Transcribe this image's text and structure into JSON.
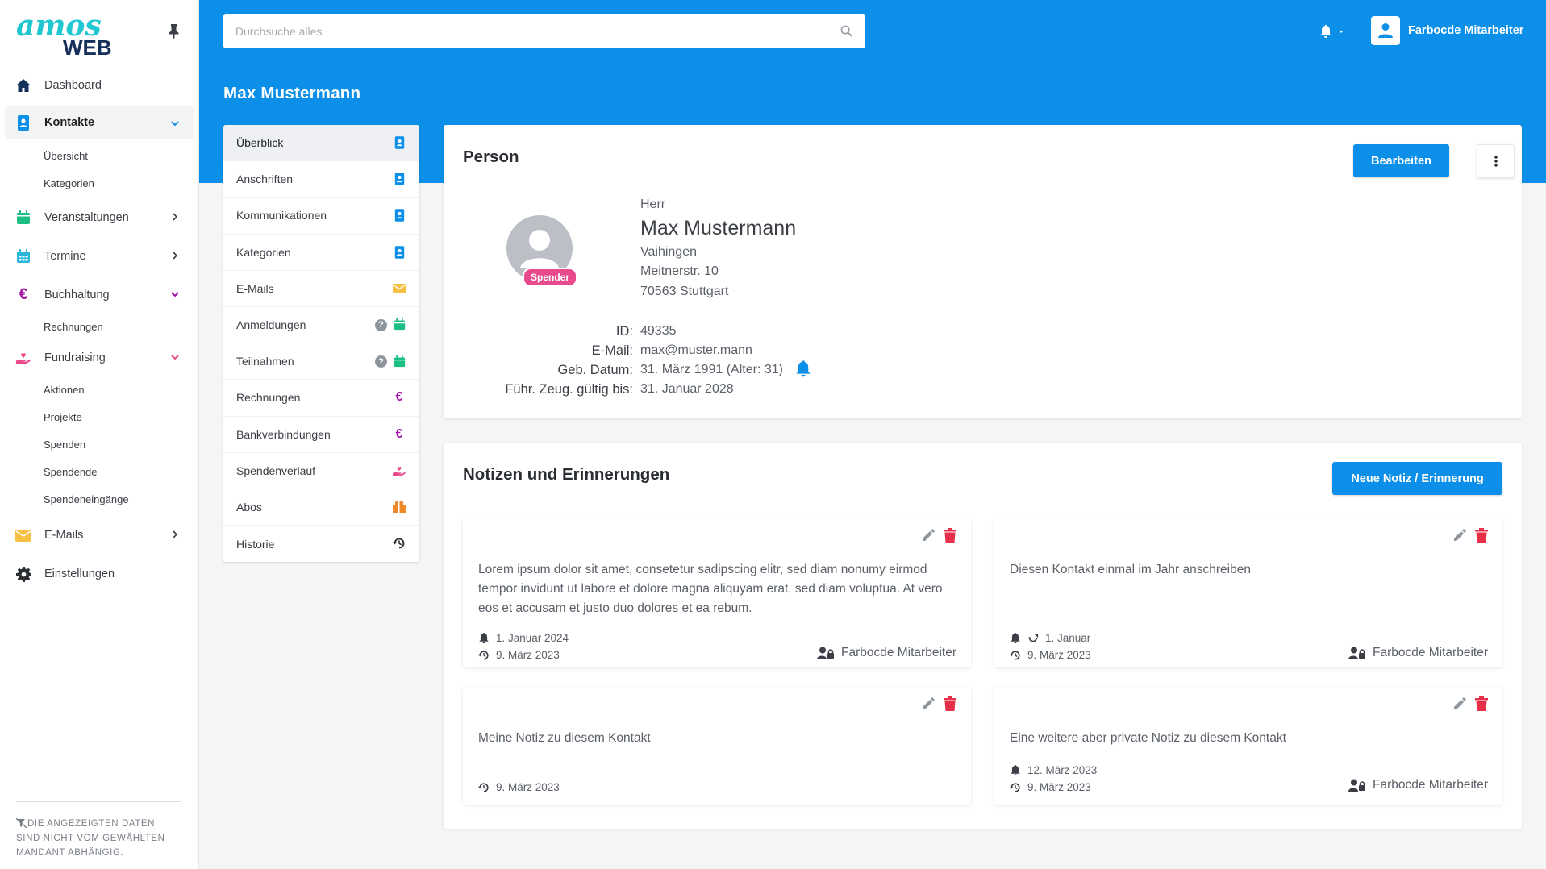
{
  "brand": {
    "logo_text_top": "amos",
    "logo_text_bottom": "WEB"
  },
  "sidebar": {
    "dashboard": "Dashboard",
    "kontakte": "Kontakte",
    "kontakte_sub": [
      "Übersicht",
      "Kategorien"
    ],
    "veranstaltungen": "Veranstaltungen",
    "termine": "Termine",
    "buchhaltung": "Buchhaltung",
    "buchhaltung_sub": [
      "Rechnungen"
    ],
    "fundraising": "Fundraising",
    "fundraising_sub": [
      "Aktionen",
      "Projekte",
      "Spenden",
      "Spendende",
      "Spendeneingänge"
    ],
    "emails": "E-Mails",
    "einstellungen": "Einstellungen",
    "footer_note_1": "Die angezeigten Daten",
    "footer_note_2": "sind nicht vom gewählten",
    "footer_note_3": "Mandant abhängig."
  },
  "header": {
    "search_placeholder": "Durchsuche alles",
    "user_name": "Farbocde Mitarbeiter",
    "page_title": "Max Mustermann"
  },
  "submenu": [
    "Überblick",
    "Anschriften",
    "Kommunikationen",
    "Kategorien",
    "E-Mails",
    "Anmeldungen",
    "Teilnahmen",
    "Rechnungen",
    "Bankverbindungen",
    "Spendenverlauf",
    "Abos",
    "Historie"
  ],
  "person": {
    "card_title": "Person",
    "edit_button": "Bearbeiten",
    "badge": "Spender",
    "salutation": "Herr",
    "name": "Max Mustermann",
    "district": "Vaihingen",
    "street": "Meitnerstr. 10",
    "city": "70563 Stuttgart",
    "id_label": "ID:",
    "id_value": "49335",
    "email_label": "E-Mail:",
    "email_value": "max@muster.mann",
    "birth_label": "Geb. Datum:",
    "birth_value": "31. März 1991 (Alter: 31)",
    "license_label": "Führ. Zeug. gültig bis:",
    "license_value": "31. Januar 2028"
  },
  "notes": {
    "card_title": "Notizen und Erinnerungen",
    "new_button": "Neue Notiz / Erinnerung",
    "items": [
      {
        "text": "Lorem ipsum dolor sit amet, consetetur sadipscing elitr, sed diam nonumy eirmod tempor invidunt ut labore et dolore magna aliquyam erat, sed diam voluptua. At vero eos et accusam et justo duo dolores et ea rebum.",
        "reminder": "1. Januar 2024",
        "created": "9. März 2023",
        "author": "Farbocde Mitarbeiter"
      },
      {
        "text": "Diesen Kontakt einmal im Jahr anschreiben",
        "reminder": "1. Januar",
        "created": "9. März 2023",
        "author": "Farbocde Mitarbeiter"
      },
      {
        "text": "Meine Notiz zu diesem Kontakt",
        "created": "9. März 2023"
      },
      {
        "text": "Eine weitere aber private Notiz zu diesem Kontakt",
        "reminder": "12. März 2023",
        "created": "9. März 2023",
        "author": "Farbocde Mitarbeiter"
      }
    ]
  },
  "colors": {
    "primary": "#0b8fe8",
    "green": "#1cbf83",
    "purple": "#a214a8",
    "pink": "#e94a8b",
    "yellow": "#f5c043",
    "orange": "#ef8a2a",
    "red": "#e6304a"
  }
}
